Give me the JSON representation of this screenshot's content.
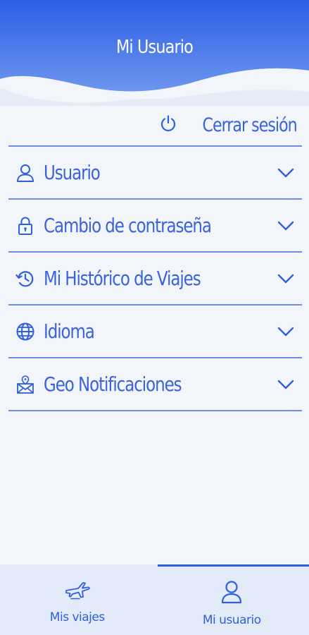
{
  "header": {
    "title": "Mi Usuario"
  },
  "logout": {
    "label": "Cerrar sesión",
    "icon": "power-icon"
  },
  "menu": {
    "items": [
      {
        "label": "Usuario",
        "icon": "user-icon"
      },
      {
        "label": "Cambio de contraseña",
        "icon": "lock-icon"
      },
      {
        "label": "Mi Histórico de Viajes",
        "icon": "history-icon"
      },
      {
        "label": "Idioma",
        "icon": "globe-icon"
      },
      {
        "label": "Geo Notificaciones",
        "icon": "geo-mail-icon"
      }
    ]
  },
  "bottom_nav": {
    "tabs": [
      {
        "label": "Mis viajes",
        "icon": "plane-icon",
        "active": false
      },
      {
        "label": "Mi usuario",
        "icon": "user-icon",
        "active": true
      }
    ]
  },
  "colors": {
    "accent": "#2f5fe0",
    "background": "#f2f5fa",
    "nav_background": "#e3ebf8"
  }
}
